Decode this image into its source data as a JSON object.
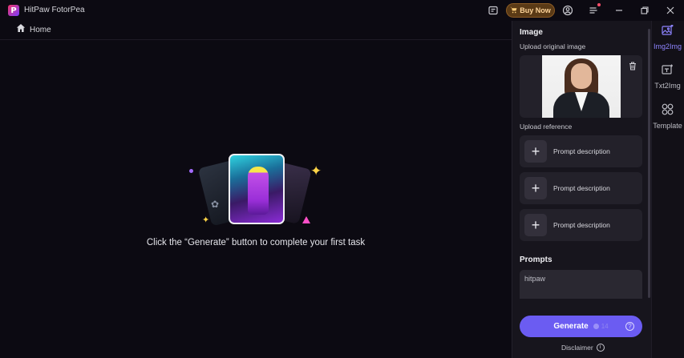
{
  "app": {
    "title": "HitPaw FotorPea",
    "logo_letter": "P"
  },
  "titlebar": {
    "buy_label": "Buy Now"
  },
  "nav": {
    "home_label": "Home"
  },
  "main": {
    "empty_message": "Click the “Generate” button to complete your first task"
  },
  "panel": {
    "image_title": "Image",
    "upload_original_label": "Upload original image",
    "upload_reference_label": "Upload reference",
    "reference_items": [
      {
        "label": "Prompt description"
      },
      {
        "label": "Prompt description"
      },
      {
        "label": "Prompt description"
      }
    ],
    "prompts_title": "Prompts",
    "prompt_value": "hitpaw",
    "generate_label": "Generate",
    "generate_cost": "14",
    "disclaimer_label": "Disclaimer"
  },
  "rail": {
    "items": [
      {
        "label": "Img2Img",
        "icon": "image-edit-icon",
        "active": true
      },
      {
        "label": "Txt2Img",
        "icon": "text-image-icon",
        "active": false
      },
      {
        "label": "Template",
        "icon": "template-icon",
        "active": false
      }
    ]
  },
  "colors": {
    "accent": "#6b5cf2",
    "buy": "#5a3a16",
    "panel": "#17151d",
    "background": "#0c0a12"
  }
}
